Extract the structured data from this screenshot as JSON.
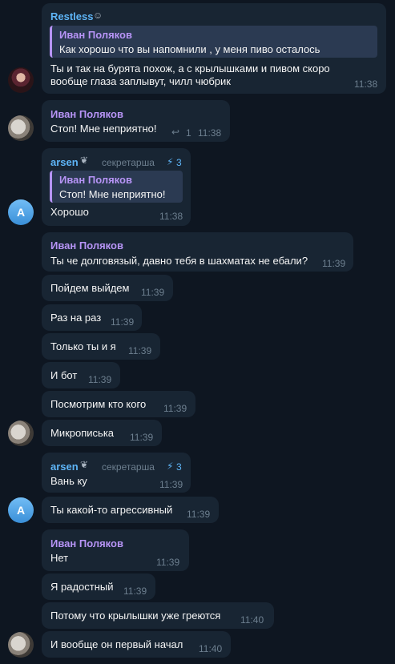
{
  "m1": {
    "sender": "Restless",
    "sender_emoji": "☺",
    "quote_name": "Иван Поляков",
    "quote_text": "Как хорошо что вы напомнили , у меня пиво осталось",
    "line1": "Ты и так на бурята похож, а с крылышками и пивом скоро",
    "line2": "вообще глаза заплывут, чилл чюбрик",
    "time": "11:38"
  },
  "m2": {
    "sender": "Иван Поляков",
    "text": "Стоп! Мне неприятно!",
    "reply_icon": "↩",
    "reply_count": "1",
    "time": "11:38"
  },
  "m3": {
    "sender": "arsen",
    "role": "секретарша",
    "boost": "3",
    "quote_name": "Иван Поляков",
    "quote_text": "Стоп! Мне неприятно!",
    "text": "Хорошо",
    "time": "11:38",
    "avatar_letter": "A"
  },
  "g1": [
    {
      "text": "Ты че долговязый, давно тебя в шахматах не ебали?",
      "time": "11:39",
      "sender": "Иван Поляков"
    },
    {
      "text": "Пойдем выйдем",
      "time": "11:39"
    },
    {
      "text": "Раз на раз",
      "time": "11:39"
    },
    {
      "text": "Только ты и я",
      "time": "11:39"
    },
    {
      "text": "И бот",
      "time": "11:39"
    },
    {
      "text": "Посмотрим кто кого",
      "time": "11:39"
    },
    {
      "text": "Микрописька",
      "time": "11:39"
    }
  ],
  "m4": {
    "sender": "arsen",
    "role": "секретарша",
    "boost": "3",
    "text": "Вань ку",
    "time": "11:39"
  },
  "m5": {
    "text": "Ты какой-то агрессивный",
    "time": "11:39",
    "avatar_letter": "A"
  },
  "g2": [
    {
      "text": "Нет",
      "time": "11:39",
      "sender": "Иван Поляков"
    },
    {
      "text": "Я радостный",
      "time": "11:39"
    },
    {
      "text": "Потому что крылышки уже греются",
      "time": "11:40"
    },
    {
      "text": "И вообще он первый начал",
      "time": "11:40"
    }
  ],
  "colors": {
    "background": "#0e1621",
    "bubble": "#182533",
    "name_purple": "#b794f6",
    "name_blue": "#5eb5f7",
    "time": "#6d7f8f"
  }
}
